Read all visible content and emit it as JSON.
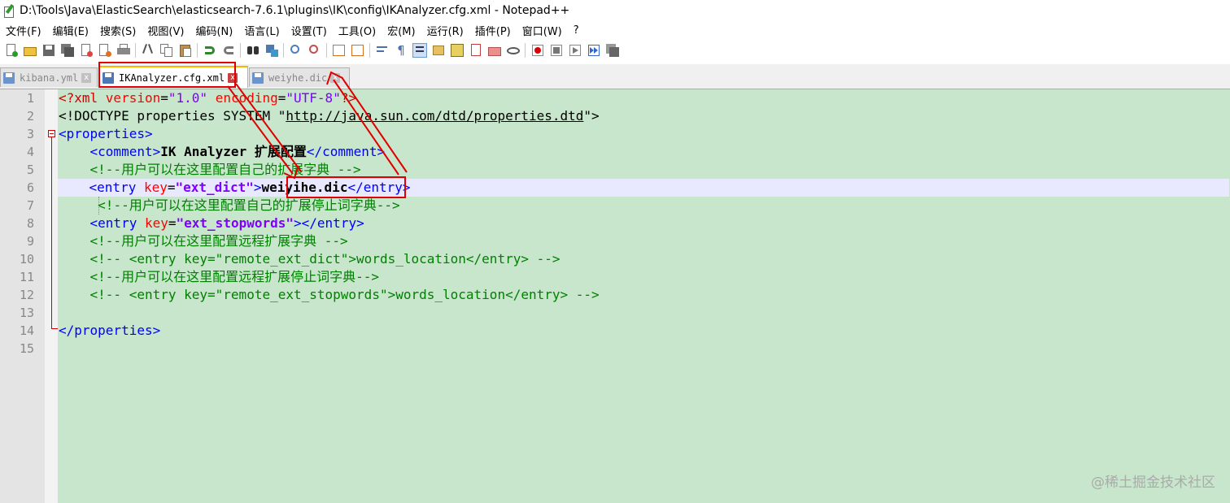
{
  "window": {
    "title": "D:\\Tools\\Java\\ElasticSearch\\elasticsearch-7.6.1\\plugins\\IK\\config\\IKAnalyzer.cfg.xml - Notepad++"
  },
  "menu": {
    "items": [
      "文件(F)",
      "编辑(E)",
      "搜索(S)",
      "视图(V)",
      "编码(N)",
      "语言(L)",
      "设置(T)",
      "工具(O)",
      "宏(M)",
      "运行(R)",
      "插件(P)",
      "窗口(W)",
      "?"
    ]
  },
  "tabs": [
    {
      "label": "kibana.yml",
      "close": "x"
    },
    {
      "label": "IKAnalyzer.cfg.xml",
      "close": "x"
    },
    {
      "label": "weiyhe.dic",
      "close": "x"
    }
  ],
  "editor": {
    "line_numbers": [
      "1",
      "2",
      "3",
      "4",
      "5",
      "6",
      "7",
      "8",
      "9",
      "10",
      "11",
      "12",
      "13",
      "14",
      "15"
    ],
    "lines": {
      "l1": {
        "a": "<?xml ",
        "b": "version",
        "c": "=",
        "d": "\"1.0\"",
        "e": " ",
        "f": "encoding",
        "g": "=",
        "h": "\"UTF-8\"",
        "i": "?>"
      },
      "l2": {
        "a": "<!DOCTYPE properties SYSTEM \"",
        "b": "http://java.sun.com/dtd/properties.dtd",
        "c": "\">"
      },
      "l3": {
        "a": "<properties>"
      },
      "l4": {
        "a": "    ",
        "b": "<comment>",
        "c": "IK Analyzer 扩展配置",
        "d": "</comment>"
      },
      "l5": {
        "a": "    ",
        "b": "<!--用户可以在这里配置自己的扩展字典 -->"
      },
      "l6": {
        "a": "    ",
        "b": "<entry ",
        "c": "key",
        "d": "=",
        "e": "\"ext_dict\"",
        "f": ">",
        "g": "weiyihe.dic",
        "h": "</entry>"
      },
      "l7": {
        "a": "     ",
        "b": "<!--用户可以在这里配置自己的扩展停止词字典-->"
      },
      "l8": {
        "a": "    ",
        "b": "<entry ",
        "c": "key",
        "d": "=",
        "e": "\"ext_stopwords\"",
        "f": "></entry>"
      },
      "l9": {
        "a": "    ",
        "b": "<!--用户可以在这里配置远程扩展字典 -->"
      },
      "l10": {
        "a": "    ",
        "b": "<!-- <entry key=\"remote_ext_dict\">words_location</entry> -->"
      },
      "l11": {
        "a": "    ",
        "b": "<!--用户可以在这里配置远程扩展停止词字典-->"
      },
      "l12": {
        "a": "    ",
        "b": "<!-- <entry key=\"remote_ext_stopwords\">words_location</entry> -->"
      },
      "l14": {
        "a": "</properties>"
      }
    }
  },
  "watermark": "@稀土掘金技术社区",
  "colors": {
    "editor_bg": "#c7e6cb",
    "annotation_red": "#e00000",
    "current_line": "#e8e8ff"
  }
}
